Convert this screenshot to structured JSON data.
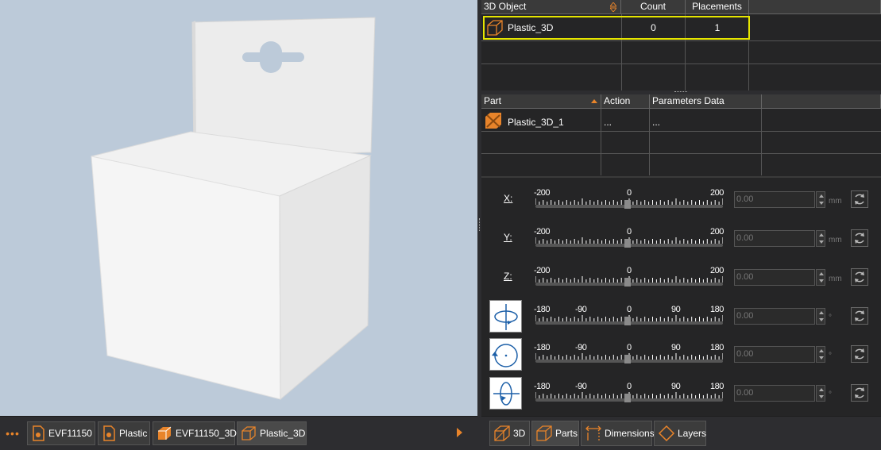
{
  "viewport": {
    "background": "#bccad9"
  },
  "doc_tabs": {
    "more_label": "•••",
    "items": [
      {
        "label": "EVF11150",
        "icon": "document-icon"
      },
      {
        "label": "Plastic",
        "icon": "document-icon"
      },
      {
        "label": "EVF11150_3D",
        "icon": "box-3d-icon"
      },
      {
        "label": "Plastic_3D",
        "icon": "box-3d-icon"
      }
    ]
  },
  "object_grid": {
    "headers": {
      "object": "3D Object",
      "count": "Count",
      "placements": "Placements"
    },
    "rows": [
      {
        "name": "Plastic_3D",
        "count": "0",
        "placements": "1"
      }
    ]
  },
  "part_grid": {
    "headers": {
      "part": "Part",
      "action": "Action",
      "params": "Parameters Data"
    },
    "rows": [
      {
        "name": "Plastic_3D_1",
        "action": "...",
        "params": "..."
      }
    ]
  },
  "transform": {
    "rows": [
      {
        "label": "X:",
        "value": "0.00",
        "unit": "mm",
        "ticks": [
          "-200",
          "0",
          "200"
        ]
      },
      {
        "label": "Y:",
        "value": "0.00",
        "unit": "mm",
        "ticks": [
          "-200",
          "0",
          "200"
        ]
      },
      {
        "label": "Z:",
        "value": "0.00",
        "unit": "mm",
        "ticks": [
          "-200",
          "0",
          "200"
        ]
      },
      {
        "icon": "rotate-x-icon",
        "value": "0.00",
        "unit": "°",
        "ticks": [
          "-180",
          "-90",
          "0",
          "90",
          "180"
        ]
      },
      {
        "icon": "rotate-z-icon",
        "value": "0.00",
        "unit": "°",
        "ticks": [
          "-180",
          "-90",
          "0",
          "90",
          "180"
        ]
      },
      {
        "icon": "rotate-y-icon",
        "value": "0.00",
        "unit": "°",
        "ticks": [
          "-180",
          "-90",
          "0",
          "90",
          "180"
        ]
      }
    ]
  },
  "panel_tabs": [
    {
      "label": "3D",
      "icon": "cube-icon"
    },
    {
      "label": "Parts",
      "icon": "parts-icon"
    },
    {
      "label": "Dimensions",
      "icon": "dimensions-icon"
    },
    {
      "label": "Layers",
      "icon": "layers-icon"
    }
  ],
  "colors": {
    "accent": "#e8842a",
    "selection": "#e6e600"
  }
}
